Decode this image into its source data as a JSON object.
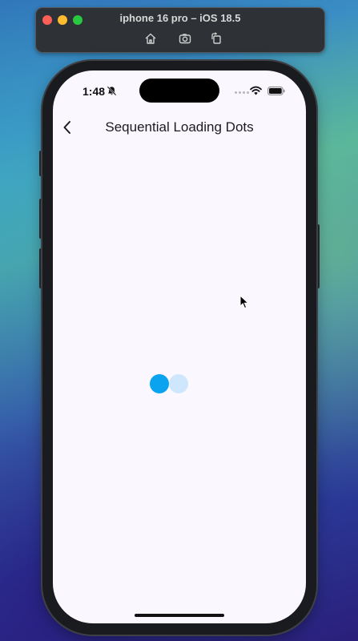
{
  "simulator": {
    "title": "iphone 16 pro – iOS 18.5",
    "buttons": [
      {
        "icon": "home-icon"
      },
      {
        "icon": "screenshot-icon"
      },
      {
        "icon": "rotate-icon"
      }
    ]
  },
  "status_bar": {
    "time": "1:48",
    "icons": [
      "bell-slash-icon",
      "wifi-icon",
      "battery-icon"
    ]
  },
  "nav": {
    "back_icon": "chevron-left-icon",
    "title": "Sequential Loading Dots"
  },
  "loader": {
    "dots": [
      {
        "state": "active",
        "color": "#0aa3ef"
      },
      {
        "state": "inactive",
        "color": "#cfe7fd"
      }
    ]
  },
  "colors": {
    "screen_background": "#fbf7fe",
    "accent": "#0aa3ef"
  }
}
